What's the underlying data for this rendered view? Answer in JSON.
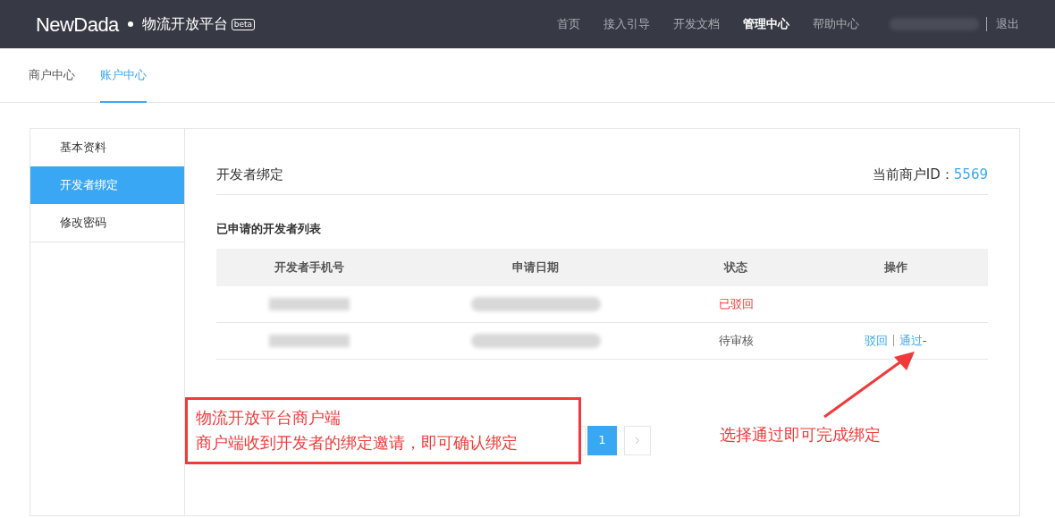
{
  "header": {
    "logo": "NewDada",
    "platform": "物流开放平台",
    "badge": "beta",
    "nav": [
      {
        "label": "首页",
        "selected": false
      },
      {
        "label": "接入引导",
        "selected": false
      },
      {
        "label": "开发文档",
        "selected": false
      },
      {
        "label": "管理中心",
        "selected": true
      },
      {
        "label": "帮助中心",
        "selected": false
      }
    ],
    "logout": "退出"
  },
  "tabs": [
    {
      "label": "商户中心",
      "selected": false
    },
    {
      "label": "账户中心",
      "selected": true
    }
  ],
  "sidebar": {
    "items": [
      {
        "label": "基本资料",
        "selected": false
      },
      {
        "label": "开发者绑定",
        "selected": true
      },
      {
        "label": "修改密码",
        "selected": false
      }
    ]
  },
  "content": {
    "title": "开发者绑定",
    "merchant_id_label": "当前商户ID：",
    "merchant_id": "5569",
    "list_title": "已申请的开发者列表",
    "table": {
      "columns": [
        "开发者手机号",
        "申请日期",
        "状态",
        "操作"
      ],
      "rows": [
        {
          "status": "已驳回",
          "kind": "rejected",
          "actions": []
        },
        {
          "status": "待审核",
          "kind": "pending",
          "actions": [
            "驳回",
            "通过"
          ],
          "trail": "-"
        }
      ]
    },
    "pagination": {
      "pages": [
        {
          "label": "1",
          "selected": true
        }
      ]
    }
  },
  "annotations": {
    "box_lines": [
      "物流开放平台商户端",
      "商户端收到开发者的绑定邀请，即可确认绑定"
    ],
    "arrow_note": "选择通过即可完成绑定"
  }
}
